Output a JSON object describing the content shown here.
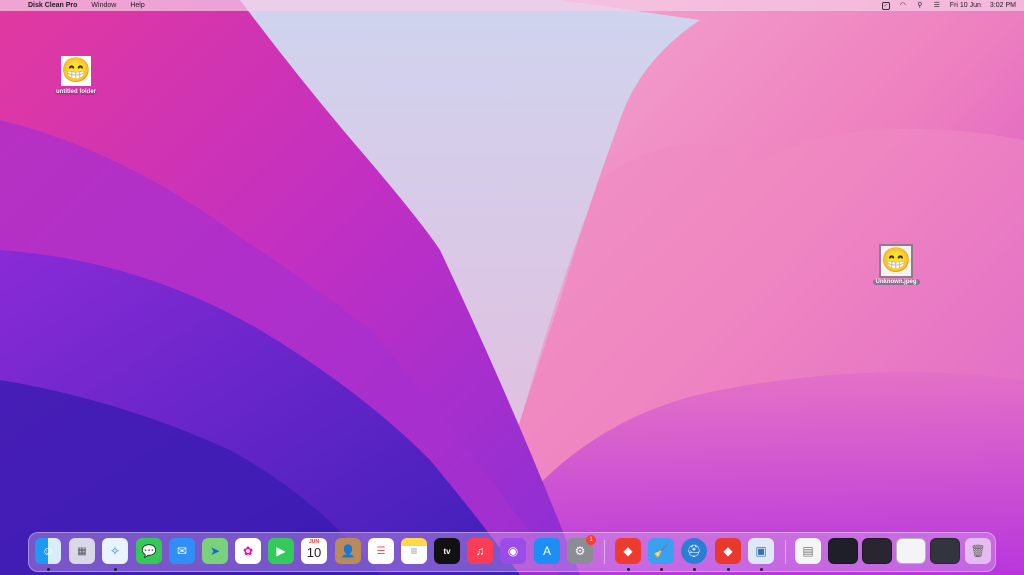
{
  "menubar": {
    "apple_glyph": "",
    "app_name": "Disk Clean Pro",
    "menus": [
      "Window",
      "Help"
    ],
    "status": {
      "date": "Fri 10 Jun",
      "time": "3:02 PM"
    }
  },
  "desktop": {
    "icons": [
      {
        "label": "untitled folder",
        "emoji": "😁"
      },
      {
        "label": "Unknown.jpeg",
        "emoji": "😁"
      }
    ]
  },
  "dock": {
    "calendar": {
      "month": "JUN",
      "day": "10"
    },
    "system_preferences_badge": "1",
    "tv_label": "tv",
    "apps": [
      "finder-icon",
      "launchpad-icon",
      "safari-icon",
      "messages-icon",
      "mail-icon",
      "maps-icon",
      "photos-icon",
      "facetime-icon",
      "calendar-icon",
      "contacts-icon",
      "reminders-icon",
      "notes-icon",
      "apple-tv-icon",
      "music-icon",
      "podcasts-icon",
      "app-store-icon",
      "system-preferences-icon",
      "anydesk-icon",
      "disk-clean-pro-icon",
      "disk-utility-icon",
      "anydesk-alt-icon",
      "preview-icon",
      "document-icon",
      "window-thumbnail-1",
      "window-thumbnail-2",
      "window-thumbnail-3",
      "window-thumbnail-4",
      "trash-icon"
    ]
  },
  "colors": {
    "wallpaper_dark": "#4a1fc2",
    "wallpaper_magenta": "#d23aa8",
    "wallpaper_pink": "#f29bc9",
    "wallpaper_light": "#e8c8e6"
  }
}
